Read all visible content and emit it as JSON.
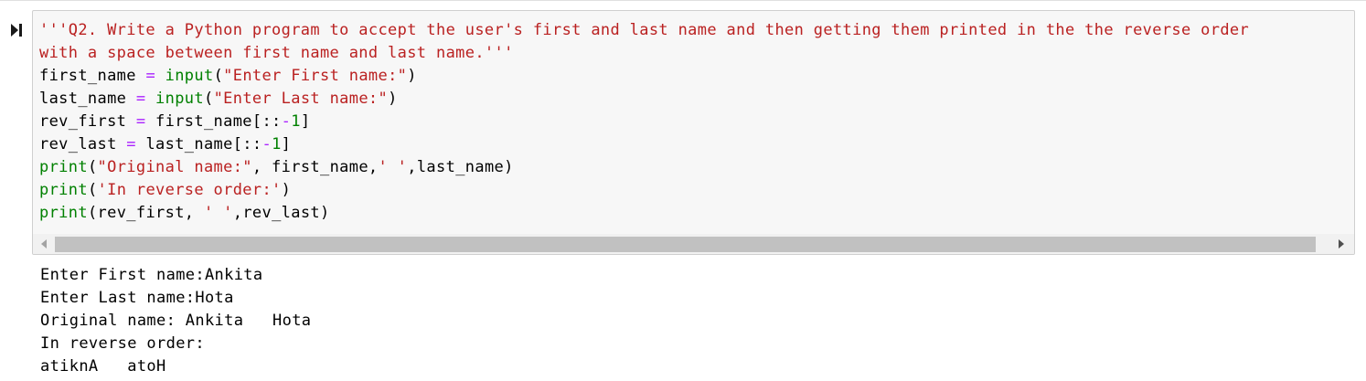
{
  "cell": {
    "run_icon": "run-cell-icon",
    "code_lines": [
      [
        {
          "t": "'''Q2. Write a Python program to accept the user's first and last name and then getting them printed in the the reverse order",
          "c": "str"
        }
      ],
      [
        {
          "t": "with a space between first name and last name.'''",
          "c": "str"
        }
      ],
      [
        {
          "t": "first_name ",
          "c": "name"
        },
        {
          "t": "=",
          "c": "op"
        },
        {
          "t": " ",
          "c": "name"
        },
        {
          "t": "input",
          "c": "bi"
        },
        {
          "t": "(",
          "c": "name"
        },
        {
          "t": "\"Enter First name:\"",
          "c": "str"
        },
        {
          "t": ")",
          "c": "name"
        }
      ],
      [
        {
          "t": "last_name ",
          "c": "name"
        },
        {
          "t": "=",
          "c": "op"
        },
        {
          "t": " ",
          "c": "name"
        },
        {
          "t": "input",
          "c": "bi"
        },
        {
          "t": "(",
          "c": "name"
        },
        {
          "t": "\"Enter Last name:\"",
          "c": "str"
        },
        {
          "t": ")",
          "c": "name"
        }
      ],
      [
        {
          "t": "rev_first ",
          "c": "name"
        },
        {
          "t": "=",
          "c": "op"
        },
        {
          "t": " first_name[::",
          "c": "name"
        },
        {
          "t": "-",
          "c": "op"
        },
        {
          "t": "1",
          "c": "num"
        },
        {
          "t": "]",
          "c": "name"
        }
      ],
      [
        {
          "t": "rev_last ",
          "c": "name"
        },
        {
          "t": "=",
          "c": "op"
        },
        {
          "t": " last_name[::",
          "c": "name"
        },
        {
          "t": "-",
          "c": "op"
        },
        {
          "t": "1",
          "c": "num"
        },
        {
          "t": "]",
          "c": "name"
        }
      ],
      [
        {
          "t": "print",
          "c": "bi"
        },
        {
          "t": "(",
          "c": "name"
        },
        {
          "t": "\"Original name:\"",
          "c": "str"
        },
        {
          "t": ", first_name,",
          "c": "name"
        },
        {
          "t": "' '",
          "c": "str"
        },
        {
          "t": ",last_name)",
          "c": "name"
        }
      ],
      [
        {
          "t": "print",
          "c": "bi"
        },
        {
          "t": "(",
          "c": "name"
        },
        {
          "t": "'In reverse order:'",
          "c": "str"
        },
        {
          "t": ")",
          "c": "name"
        }
      ],
      [
        {
          "t": "print",
          "c": "bi"
        },
        {
          "t": "(rev_first, ",
          "c": "name"
        },
        {
          "t": "' '",
          "c": "str"
        },
        {
          "t": ",rev_last)",
          "c": "name"
        }
      ]
    ],
    "scrollbar": {
      "left_arrow_icon": "scroll-left-arrow-icon",
      "right_arrow_icon": "scroll-right-arrow-icon"
    }
  },
  "output": {
    "lines": [
      "Enter First name:Ankita",
      "Enter Last name:Hota",
      "Original name: Ankita   Hota",
      "In reverse order:",
      "atiknA   atoH"
    ]
  },
  "colors": {
    "string": "#ba2121",
    "builtin": "#008000",
    "operator": "#aa22ff",
    "number": "#008000",
    "cell_background": "#f7f7f7",
    "cell_border": "#cfcfcf"
  }
}
